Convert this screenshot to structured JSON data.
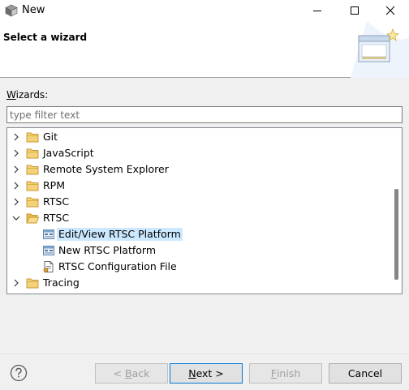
{
  "window": {
    "title": "New",
    "app_icon": "eclipse-cube-icon"
  },
  "header": {
    "title": "Select a wizard",
    "graphic": "wizard-banner-icon"
  },
  "wizards_label": {
    "mnemonic": "W",
    "rest": "izards:"
  },
  "filter": {
    "placeholder": "type filter text",
    "value": ""
  },
  "tree": {
    "items": [
      {
        "label": "Git",
        "type": "folder",
        "expanded": false,
        "level": 0
      },
      {
        "label": "JavaScript",
        "type": "folder",
        "expanded": false,
        "level": 0
      },
      {
        "label": "Remote System Explorer",
        "type": "folder",
        "expanded": false,
        "level": 0
      },
      {
        "label": "RPM",
        "type": "folder",
        "expanded": false,
        "level": 0
      },
      {
        "label": "RTSC",
        "type": "folder",
        "expanded": false,
        "level": 0
      },
      {
        "label": "RTSC",
        "type": "folder",
        "expanded": true,
        "level": 0
      },
      {
        "label": "Edit/View RTSC Platform",
        "type": "wizard",
        "selected": true,
        "level": 1
      },
      {
        "label": "New RTSC Platform",
        "type": "wizard",
        "level": 1
      },
      {
        "label": "RTSC Configuration File",
        "type": "wizard-file",
        "level": 1
      },
      {
        "label": "Tracing",
        "type": "folder",
        "expanded": false,
        "level": 0
      }
    ]
  },
  "buttons": {
    "back": {
      "prefix": "< ",
      "mnemonic": "B",
      "rest": "ack",
      "enabled": false
    },
    "next": {
      "mnemonic": "N",
      "rest": "ext >",
      "enabled": true
    },
    "finish": {
      "mnemonic": "F",
      "rest": "inish",
      "enabled": false
    },
    "cancel": {
      "label": "Cancel",
      "enabled": true
    }
  },
  "colors": {
    "selection": "#cce8ff",
    "folder": "#e8b84a",
    "default_button_border": "#0078d7"
  }
}
